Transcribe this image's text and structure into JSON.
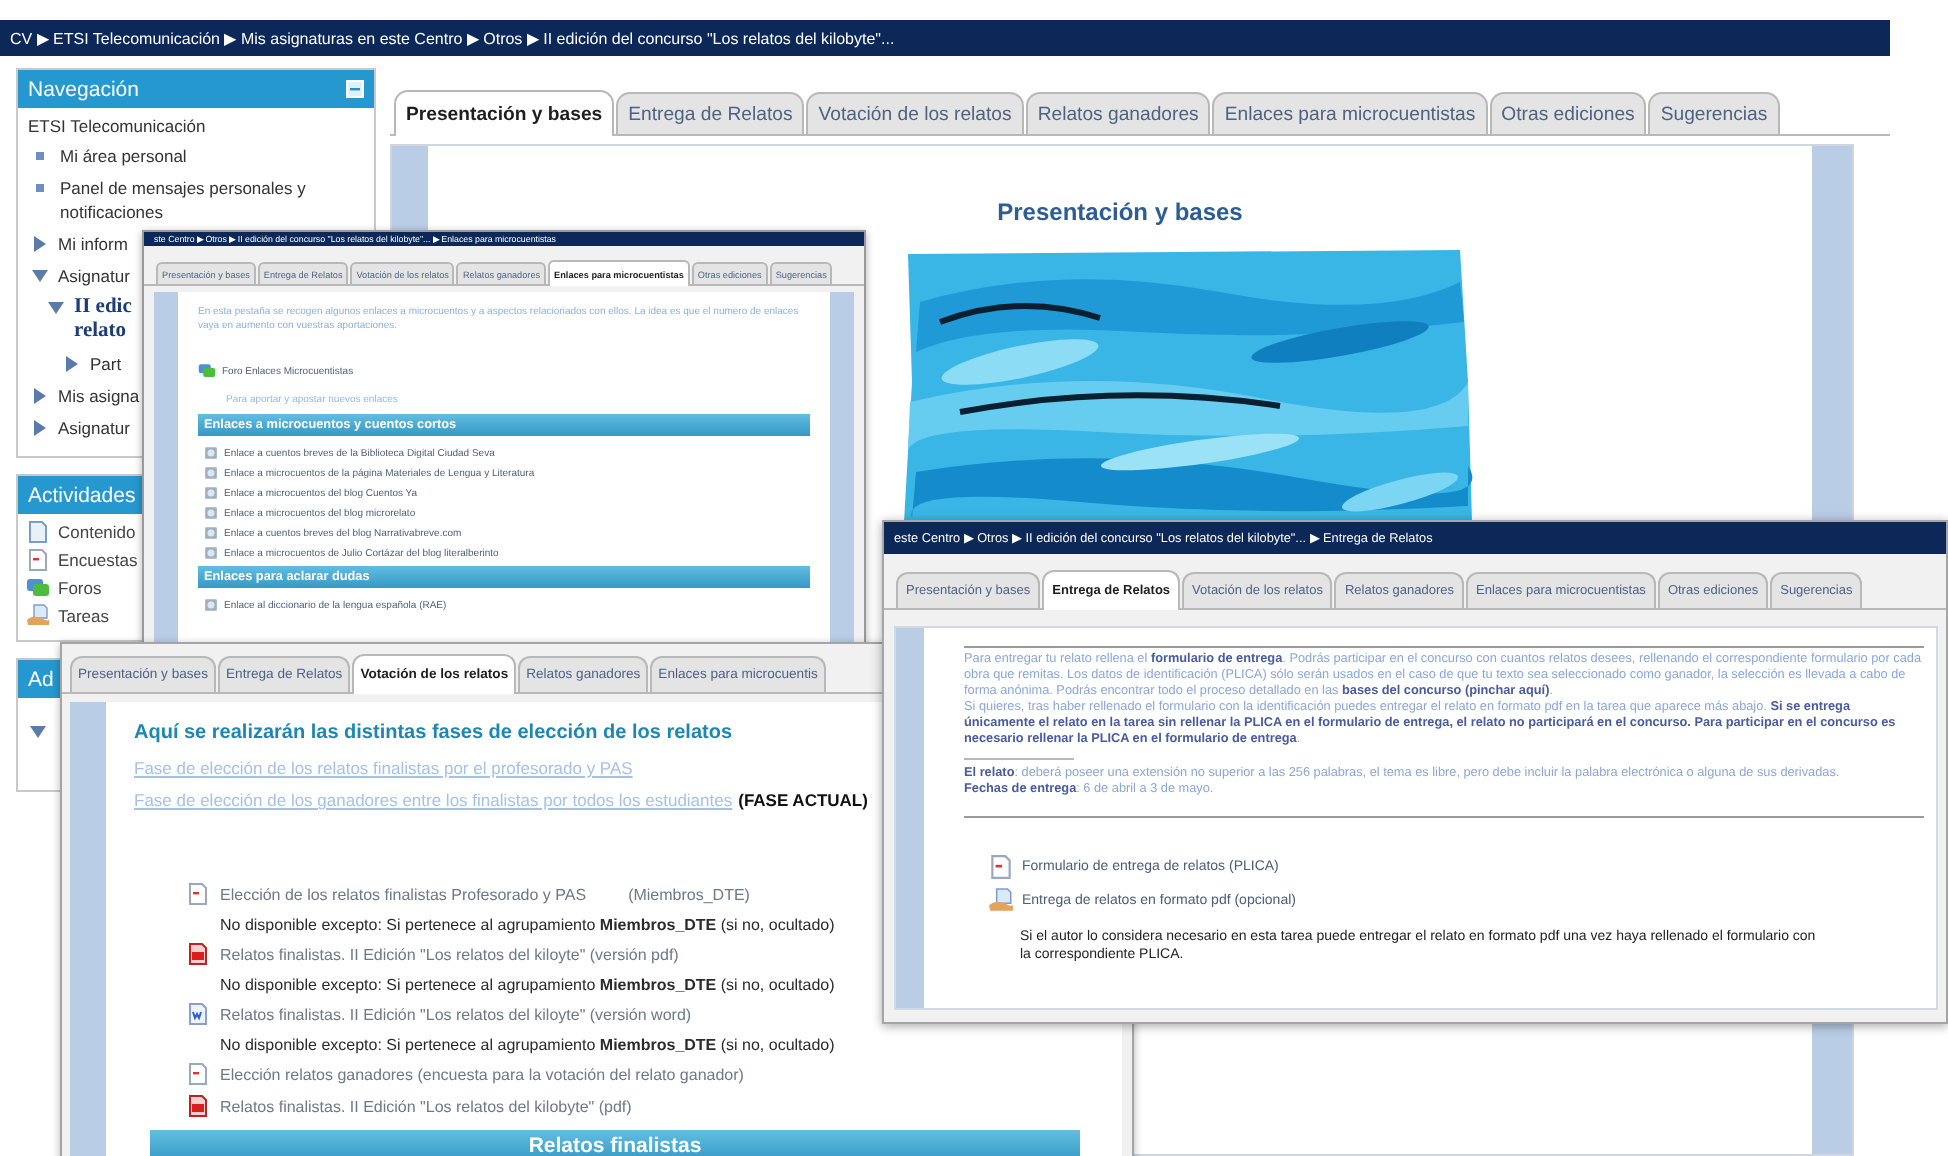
{
  "main": {
    "breadcrumb": "CV ▶ ETSI Telecomunicación ▶ Mis asignaturas en este Centro ▶ Otros ▶ II edición del concurso \"Los relatos del kilobyte\"...",
    "navigation": {
      "title": "Navegación",
      "root": "ETSI Telecomunicación",
      "items": [
        {
          "label": "Mi área personal",
          "kind": "leaf"
        },
        {
          "label": "Panel de mensajes personales y notificaciones",
          "kind": "leaf"
        },
        {
          "label": "Mi inform",
          "kind": "branch",
          "expanded": false
        },
        {
          "label": "Asignatur",
          "kind": "branch",
          "expanded": true,
          "children": [
            {
              "label": "II edic relato",
              "kind": "course",
              "expanded": true,
              "children": [
                {
                  "label": "Part",
                  "kind": "branch",
                  "expanded": false
                }
              ]
            }
          ]
        },
        {
          "label": "Mis asigna",
          "kind": "branch",
          "expanded": false
        },
        {
          "label": "Asignatur",
          "kind": "branch",
          "expanded": false
        }
      ]
    },
    "activities": {
      "title": "Actividades",
      "items": [
        {
          "label": "Contenido",
          "kind": "page"
        },
        {
          "label": "Encuestas",
          "kind": "survey"
        },
        {
          "label": "Foros",
          "kind": "forum"
        },
        {
          "label": "Tareas",
          "kind": "assignment"
        }
      ]
    },
    "administration": {
      "title": "Ad",
      "expanded": true
    },
    "tabs": [
      {
        "label": "Presentación y bases",
        "selected": true
      },
      {
        "label": "Entrega de Relatos",
        "selected": false
      },
      {
        "label": "Votación de los relatos",
        "selected": false
      },
      {
        "label": "Relatos ganadores",
        "selected": false
      },
      {
        "label": "Enlaces para microcuentistas",
        "selected": false
      },
      {
        "label": "Otras ediciones",
        "selected": false
      },
      {
        "label": "Sugerencias",
        "selected": false
      }
    ],
    "heading": "Presentación y bases"
  },
  "links_window": {
    "breadcrumb": "ste Centro ▶ Otros ▶ II edición del concurso \"Los relatos del kilobyte\"... ▶ Enlaces para microcuentistas",
    "tabs": [
      {
        "label": "Presentación y bases",
        "selected": false
      },
      {
        "label": "Entrega de Relatos",
        "selected": false
      },
      {
        "label": "Votación de los relatos",
        "selected": false
      },
      {
        "label": "Relatos ganadores",
        "selected": false
      },
      {
        "label": "Enlaces para microcuentistas",
        "selected": true
      },
      {
        "label": "Otras ediciones",
        "selected": false
      },
      {
        "label": "Sugerencias",
        "selected": false
      }
    ],
    "intro": "En esta pestaña se recogen algunos enlaces a microcuentos y a aspectos relacionados con ellos. La idea es que el numero de enlaces vaya en aumento con vuestras aportaciones.",
    "forum": {
      "label": "Foro Enlaces Microcuentistas",
      "kind": "forum"
    },
    "forum_note": "Para aportar y apostar nuevos enlaces",
    "sections": [
      {
        "title": "Enlaces a microcuentos y cuentos cortos",
        "links": [
          "Enlace a cuentos breves de la Biblioteca Digital Ciudad Seva",
          "Enlace a microcuentos de la página Materiales de Lengua y Literatura",
          "Enlace a microcuentos del blog Cuentos Ya",
          "Enlace a microcuentos del blog microrelato",
          "Enlace a cuentos breves del blog Narrativabreve.com",
          "Enlace a microcuentos de Julio Cortázar del blog literalberinto"
        ]
      },
      {
        "title": "Enlaces para aclarar dudas",
        "links": [
          "Enlace al diccionario de la lengua española (RAE)"
        ]
      }
    ]
  },
  "voting_window": {
    "tabs": [
      {
        "label": "Presentación y bases",
        "selected": false
      },
      {
        "label": "Entrega de Relatos",
        "selected": false
      },
      {
        "label": "Votación de los relatos",
        "selected": true
      },
      {
        "label": "Relatos ganadores",
        "selected": false
      },
      {
        "label": "Enlaces para microcuentis",
        "selected": false
      }
    ],
    "heading": "Aquí se realizarán las distintas fases de elección de los relatos",
    "phases": [
      {
        "label": "Fase de elección de los relatos finalistas por el profesorado y PAS"
      },
      {
        "label": "Fase de elección de los  ganadores entre los finalistas por todos los estudiantes",
        "badge": "(FASE ACTUAL)"
      }
    ],
    "items": [
      {
        "kind": "survey",
        "label": "Elección de los relatos finalistas Profesorado y PAS",
        "group": "(Miembros_DTE)",
        "note": "No disponible excepto: Si pertenece al agrupamiento **Miembros_DTE** (si no, ocultado)"
      },
      {
        "kind": "pdf",
        "label": "Relatos finalistas. II Edición \"Los relatos del kiloyte\" (versión pdf)",
        "note": "No disponible excepto: Si pertenece al agrupamiento **Miembros_DTE** (si no, ocultado)"
      },
      {
        "kind": "word",
        "label": "Relatos finalistas. II Edición \"Los relatos del kiloyte\" (versión word)",
        "note": "No disponible excepto: Si pertenece al agrupamiento **Miembros_DTE** (si no, ocultado)"
      },
      {
        "kind": "survey",
        "label": "Elección relatos ganadores (encuesta para la votación del relato ganador)"
      },
      {
        "kind": "pdf",
        "label": "Relatos finalistas. II Edición \"Los relatos del kilobyte\" (pdf)"
      }
    ],
    "section_bar": "Relatos finalistas"
  },
  "submission_window": {
    "breadcrumb": "este Centro ▶ Otros ▶ II edición del concurso \"Los relatos del kilobyte\"... ▶ Entrega de Relatos",
    "tabs": [
      {
        "label": "Presentación y bases",
        "selected": false
      },
      {
        "label": "Entrega de Relatos",
        "selected": true
      },
      {
        "label": "Votación de los relatos",
        "selected": false
      },
      {
        "label": "Relatos ganadores",
        "selected": false
      },
      {
        "label": "Enlaces para microcuentistas",
        "selected": false
      },
      {
        "label": "Otras ediciones",
        "selected": false
      },
      {
        "label": "Sugerencias",
        "selected": false
      }
    ],
    "paragraphs": [
      "Para entregar tu relato rellena el **formulario de entrega**. Podrás participar en el concurso con cuantos relatos desees, rellenando el correspondiente formulario por cada obra que remitas. Los datos de identificación (PLICA) sólo serán usados en el caso de que tu texto sea seleccionado como ganador, la selección es llevada a cabo de forma anónima. Podrás encontrar todo el proceso detallado en las **bases del concurso (pinchar aquí)**.",
      "Si quieres, tras haber rellenado el formulario con la identificación puedes entregar el relato en formato pdf en la tarea que aparece más abajo. **Si se entrega únicamente el relato en la tarea sin rellenar la PLICA en el formulario de entrega, el relato no  participará en el concurso. Para participar en el concurso es necesario rellenar la PLICA en el formulario de entrega**."
    ],
    "details": [
      "**El relato**: deberá poseer una extensión no superior a las 256 palabras,  el tema es libre,  pero debe incluir la palabra electrónica o alguna de sus derivadas.",
      "**Fechas de entrega**: 6 de abril a 3 de mayo."
    ],
    "items": [
      {
        "kind": "survey",
        "label": "Formulario de entrega de relatos (PLICA)"
      },
      {
        "kind": "assignment",
        "label": "Entrega de relatos en formato pdf (opcional)",
        "description": "Si el autor lo considera necesario en esta tarea puede entregar el relato en formato pdf una vez haya rellenado el formulario con la correspondiente PLICA."
      }
    ]
  }
}
